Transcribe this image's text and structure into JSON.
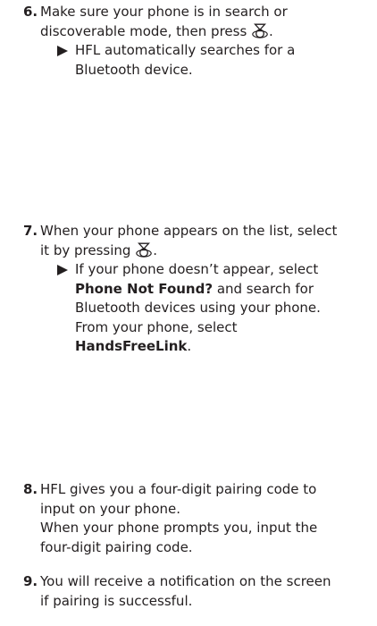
{
  "steps": [
    {
      "number": "6.",
      "line1": "Make sure your phone is in search or",
      "line2_pre": "discoverable mode, then press",
      "line2_post": ".",
      "icon": "selector-knob-icon",
      "sub_line1": "HFL automatically searches for a",
      "sub_line2": "Bluetooth device."
    },
    {
      "number": "7.",
      "line1": "When your phone appears on the list, select",
      "line2_pre": "it by pressing",
      "line2_post": ".",
      "icon": "selector-knob-icon",
      "sub_line1": "If your phone doesn’t appear, select",
      "sub_bold1": "Phone Not Found?",
      "sub_after_bold1": " and search for",
      "sub_line3": "Bluetooth devices using your phone.",
      "sub_line4": "From your phone, select",
      "sub_bold2": "HandsFreeLink",
      "sub_after_bold2": "."
    },
    {
      "number": "8.",
      "line1": "HFL gives you a four-digit pairing code to",
      "line2": "input on your phone.",
      "line3": "When your phone prompts you, input the",
      "line4": "four-digit pairing code."
    },
    {
      "number": "9.",
      "line1": "You will receive a notification on the screen",
      "line2": "if pairing is successful."
    }
  ]
}
